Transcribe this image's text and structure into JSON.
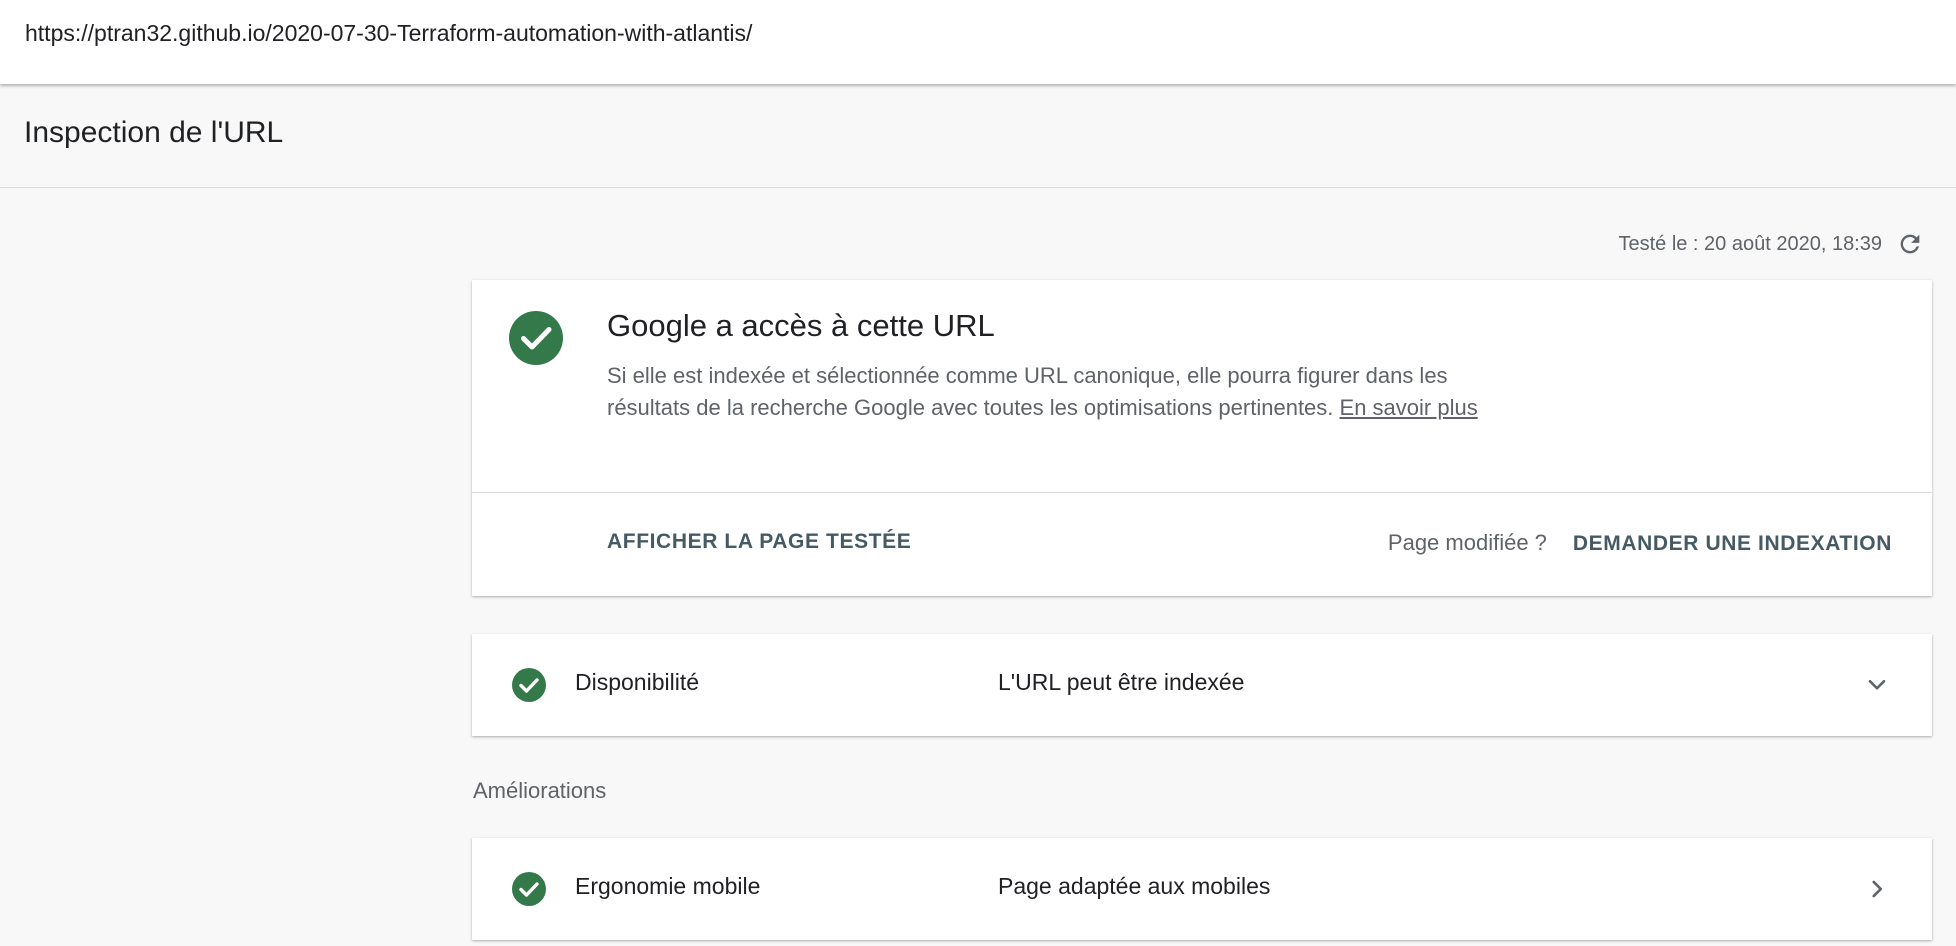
{
  "address_bar": {
    "url": "https://ptran32.github.io/2020-07-30-Terraform-automation-with-atlantis/"
  },
  "header": {
    "title": "Inspection de l'URL"
  },
  "test_info": {
    "tested_label": "Testé le : 20 août 2020, 18:39",
    "refresh_icon": "refresh-icon"
  },
  "main_card": {
    "status_icon": "check-circle-icon",
    "headline": "Google a accès à cette URL",
    "description": "Si elle est indexée et sélectionnée comme URL canonique, elle pourra figurer dans les résultats de la recherche Google avec toutes les optimisations pertinentes.",
    "learn_more": "En savoir plus",
    "view_tested_page": "AFFICHER LA PAGE TESTÉE",
    "page_modified": "Page modifiée ?",
    "request_indexing": "DEMANDER UNE INDEXATION"
  },
  "availability": {
    "status_icon": "check-circle-icon",
    "label": "Disponibilité",
    "value": "L'URL peut être indexée",
    "chevron_icon": "chevron-down-icon"
  },
  "enhancements": {
    "section_label": "Améliorations",
    "items": [
      {
        "status_icon": "check-circle-icon",
        "label": "Ergonomie mobile",
        "value": "Page adaptée aux mobiles",
        "chevron_icon": "chevron-right-icon"
      }
    ]
  },
  "colors": {
    "success_green": "#34794a",
    "action_text": "#455a64",
    "secondary_text": "#5f6368",
    "page_background": "#f8f8f8"
  }
}
